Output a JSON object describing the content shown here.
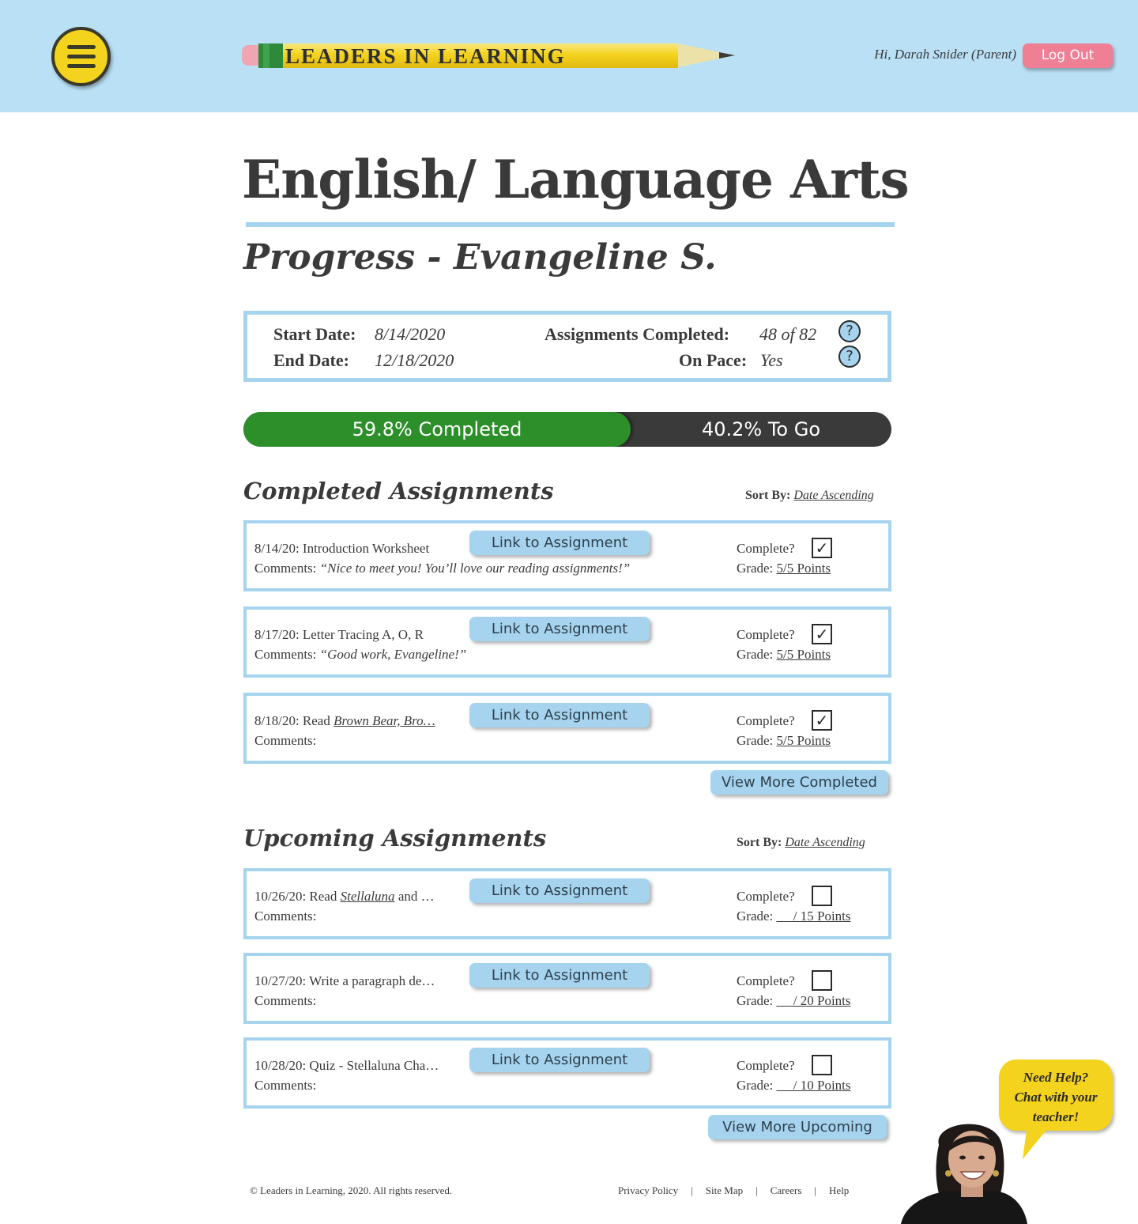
{
  "header": {
    "logo_text": "LEADERS IN LEARNING",
    "greeting": "Hi, Darah Snider (Parent)",
    "logout_label": "Log Out",
    "menu_icon": "hamburger-menu-icon"
  },
  "page": {
    "title": "English/ Language Arts",
    "subtitle": "Progress - Evangeline S."
  },
  "summary": {
    "start_label": "Start Date:",
    "start_value": "8/14/2020",
    "end_label": "End Date:",
    "end_value": "12/18/2020",
    "assignments_label": "Assignments Completed:",
    "assignments_value": "48 of 82",
    "pace_label": "On Pace:",
    "pace_value": "Yes",
    "help_glyph": "?"
  },
  "progress": {
    "completed_fraction": 0.598,
    "completed_text": "59.8% Completed",
    "togo_text": "40.2%  To Go"
  },
  "completed": {
    "title": "Completed Assignments",
    "sort_label": "Sort By:",
    "sort_value": "Date Ascending",
    "more_label": "View More Completed",
    "items": [
      {
        "prefix": "8/14/20: Introduction Worksheet",
        "title": "",
        "suffix": "",
        "comments_label": "Comments:",
        "comment": "“Nice to meet you! You’ll love our reading assignments!”",
        "link_label": "Link to Assignment",
        "complete_label": "Complete?",
        "checked": "✓",
        "grade_label": "Grade:",
        "grade_value": "5/5 Points"
      },
      {
        "prefix": "8/17/20: Letter Tracing A, O, R",
        "title": "",
        "suffix": "",
        "comments_label": "Comments:",
        "comment": "“Good work, Evangeline!”",
        "link_label": "Link to Assignment",
        "complete_label": "Complete?",
        "checked": "✓",
        "grade_label": "Grade:",
        "grade_value": "5/5 Points"
      },
      {
        "prefix": "8/18/20: Read ",
        "title": "Brown Bear, Bro…",
        "suffix": "",
        "comments_label": "Comments:",
        "comment": "",
        "link_label": "Link to Assignment",
        "complete_label": "Complete?",
        "checked": "✓",
        "grade_label": "Grade:",
        "grade_value": "5/5 Points"
      }
    ]
  },
  "upcoming": {
    "title": "Upcoming Assignments",
    "sort_label": "Sort By:",
    "sort_value": "Date Ascending",
    "more_label": "View More Upcoming",
    "items": [
      {
        "prefix": "10/26/20: Read ",
        "title": "Stellaluna",
        "suffix": " and …",
        "comments_label": "Comments:",
        "comment": "",
        "link_label": "Link to Assignment",
        "complete_label": "Complete?",
        "checked": "",
        "grade_label": "Grade:",
        "grade_value": "__ / 15 Points"
      },
      {
        "prefix": "10/27/20: Write a paragraph de…",
        "title": "",
        "suffix": "",
        "comments_label": "Comments:",
        "comment": "",
        "link_label": "Link to Assignment",
        "complete_label": "Complete?",
        "checked": "",
        "grade_label": "Grade:",
        "grade_value": "__ / 20 Points"
      },
      {
        "prefix": "10/28/20: Quiz - Stellaluna Cha…",
        "title": "",
        "suffix": "",
        "comments_label": "Comments:",
        "comment": "",
        "link_label": "Link to Assignment",
        "complete_label": "Complete?",
        "checked": "",
        "grade_label": "Grade:",
        "grade_value": "__ / 10 Points"
      }
    ]
  },
  "footer": {
    "copyright": "© Leaders in Learning, 2020. All rights reserved.",
    "links": [
      "Privacy Policy",
      "Site Map",
      "Careers",
      "Help"
    ],
    "separator": "|"
  },
  "chat": {
    "bubble_text": "Need Help?\nChat with your\nteacher!",
    "avatar_icon": "teacher-avatar-icon"
  },
  "colors": {
    "header_bg": "#bae0f5",
    "accent_blue": "#a6d4ef",
    "brand_yellow": "#f4d31e",
    "logout_pink": "#ef7f94",
    "progress_green": "#2d8f2a",
    "progress_dark": "#3a3a3a"
  }
}
